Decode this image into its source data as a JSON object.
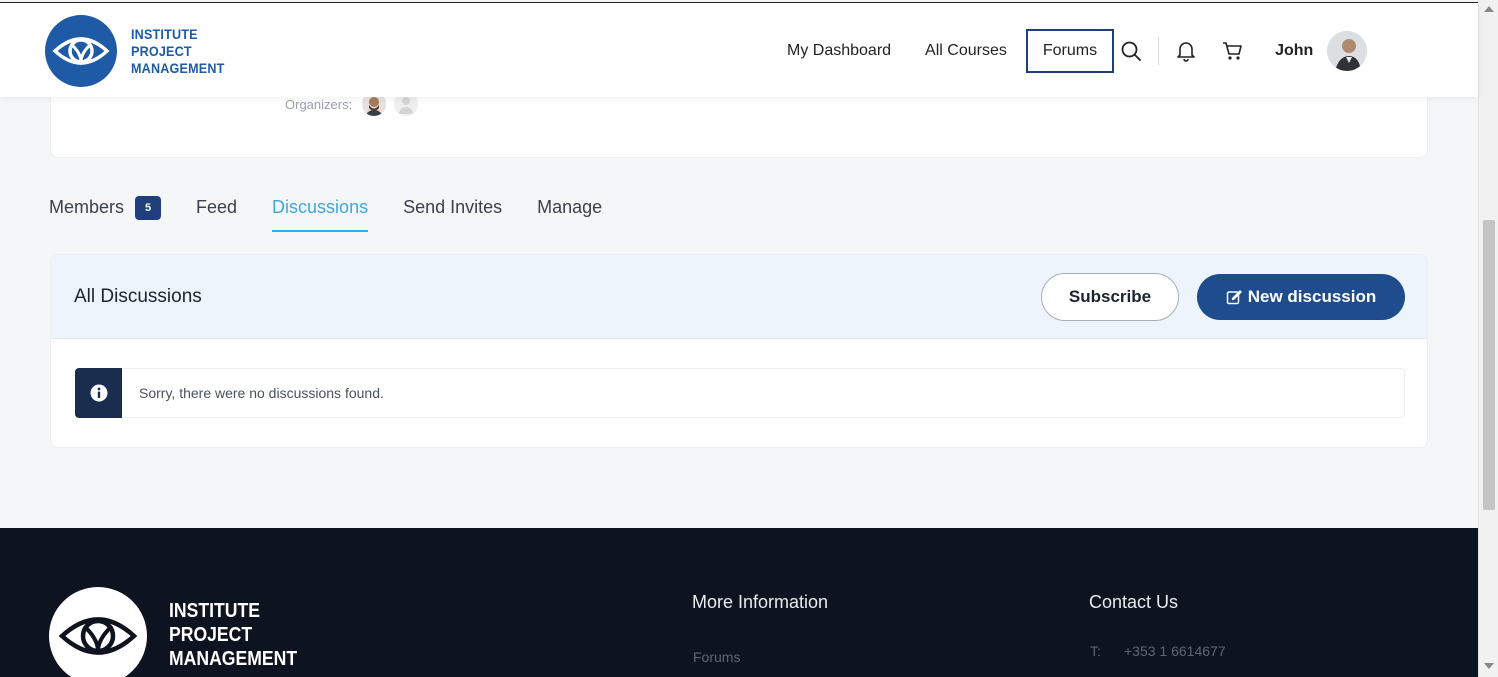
{
  "header": {
    "logo_lines": [
      "INSTITUTE",
      "PROJECT",
      "MANAGEMENT"
    ],
    "nav": [
      {
        "label": "My Dashboard",
        "active": false
      },
      {
        "label": "All Courses",
        "active": false
      },
      {
        "label": "Forums",
        "active": true
      }
    ],
    "icons": [
      "search-icon",
      "bell-icon",
      "cart-icon"
    ],
    "user_name": "John"
  },
  "group": {
    "organizers_label": "Organizers:"
  },
  "tabs": [
    {
      "label": "Members",
      "badge": "5",
      "active": false
    },
    {
      "label": "Feed",
      "active": false
    },
    {
      "label": "Discussions",
      "active": true
    },
    {
      "label": "Send Invites",
      "active": false
    },
    {
      "label": "Manage",
      "active": false
    }
  ],
  "discussions": {
    "title": "All Discussions",
    "subscribe_label": "Subscribe",
    "new_discussion_label": "New discussion",
    "empty_message": "Sorry, there were no discussions found."
  },
  "footer": {
    "logo_lines": [
      "INSTITUTE",
      "PROJECT",
      "MANAGEMENT"
    ],
    "more_info_title": "More Information",
    "more_info_links": [
      "Forums"
    ],
    "contact_title": "Contact Us",
    "phone_label": "T:",
    "phone": "+353 1 6614677"
  },
  "colors": {
    "brand_blue": "#1e5aa5",
    "active_tab": "#3fa7dc",
    "primary_button": "#1e4c8c",
    "footer_bg": "#0e1320"
  }
}
